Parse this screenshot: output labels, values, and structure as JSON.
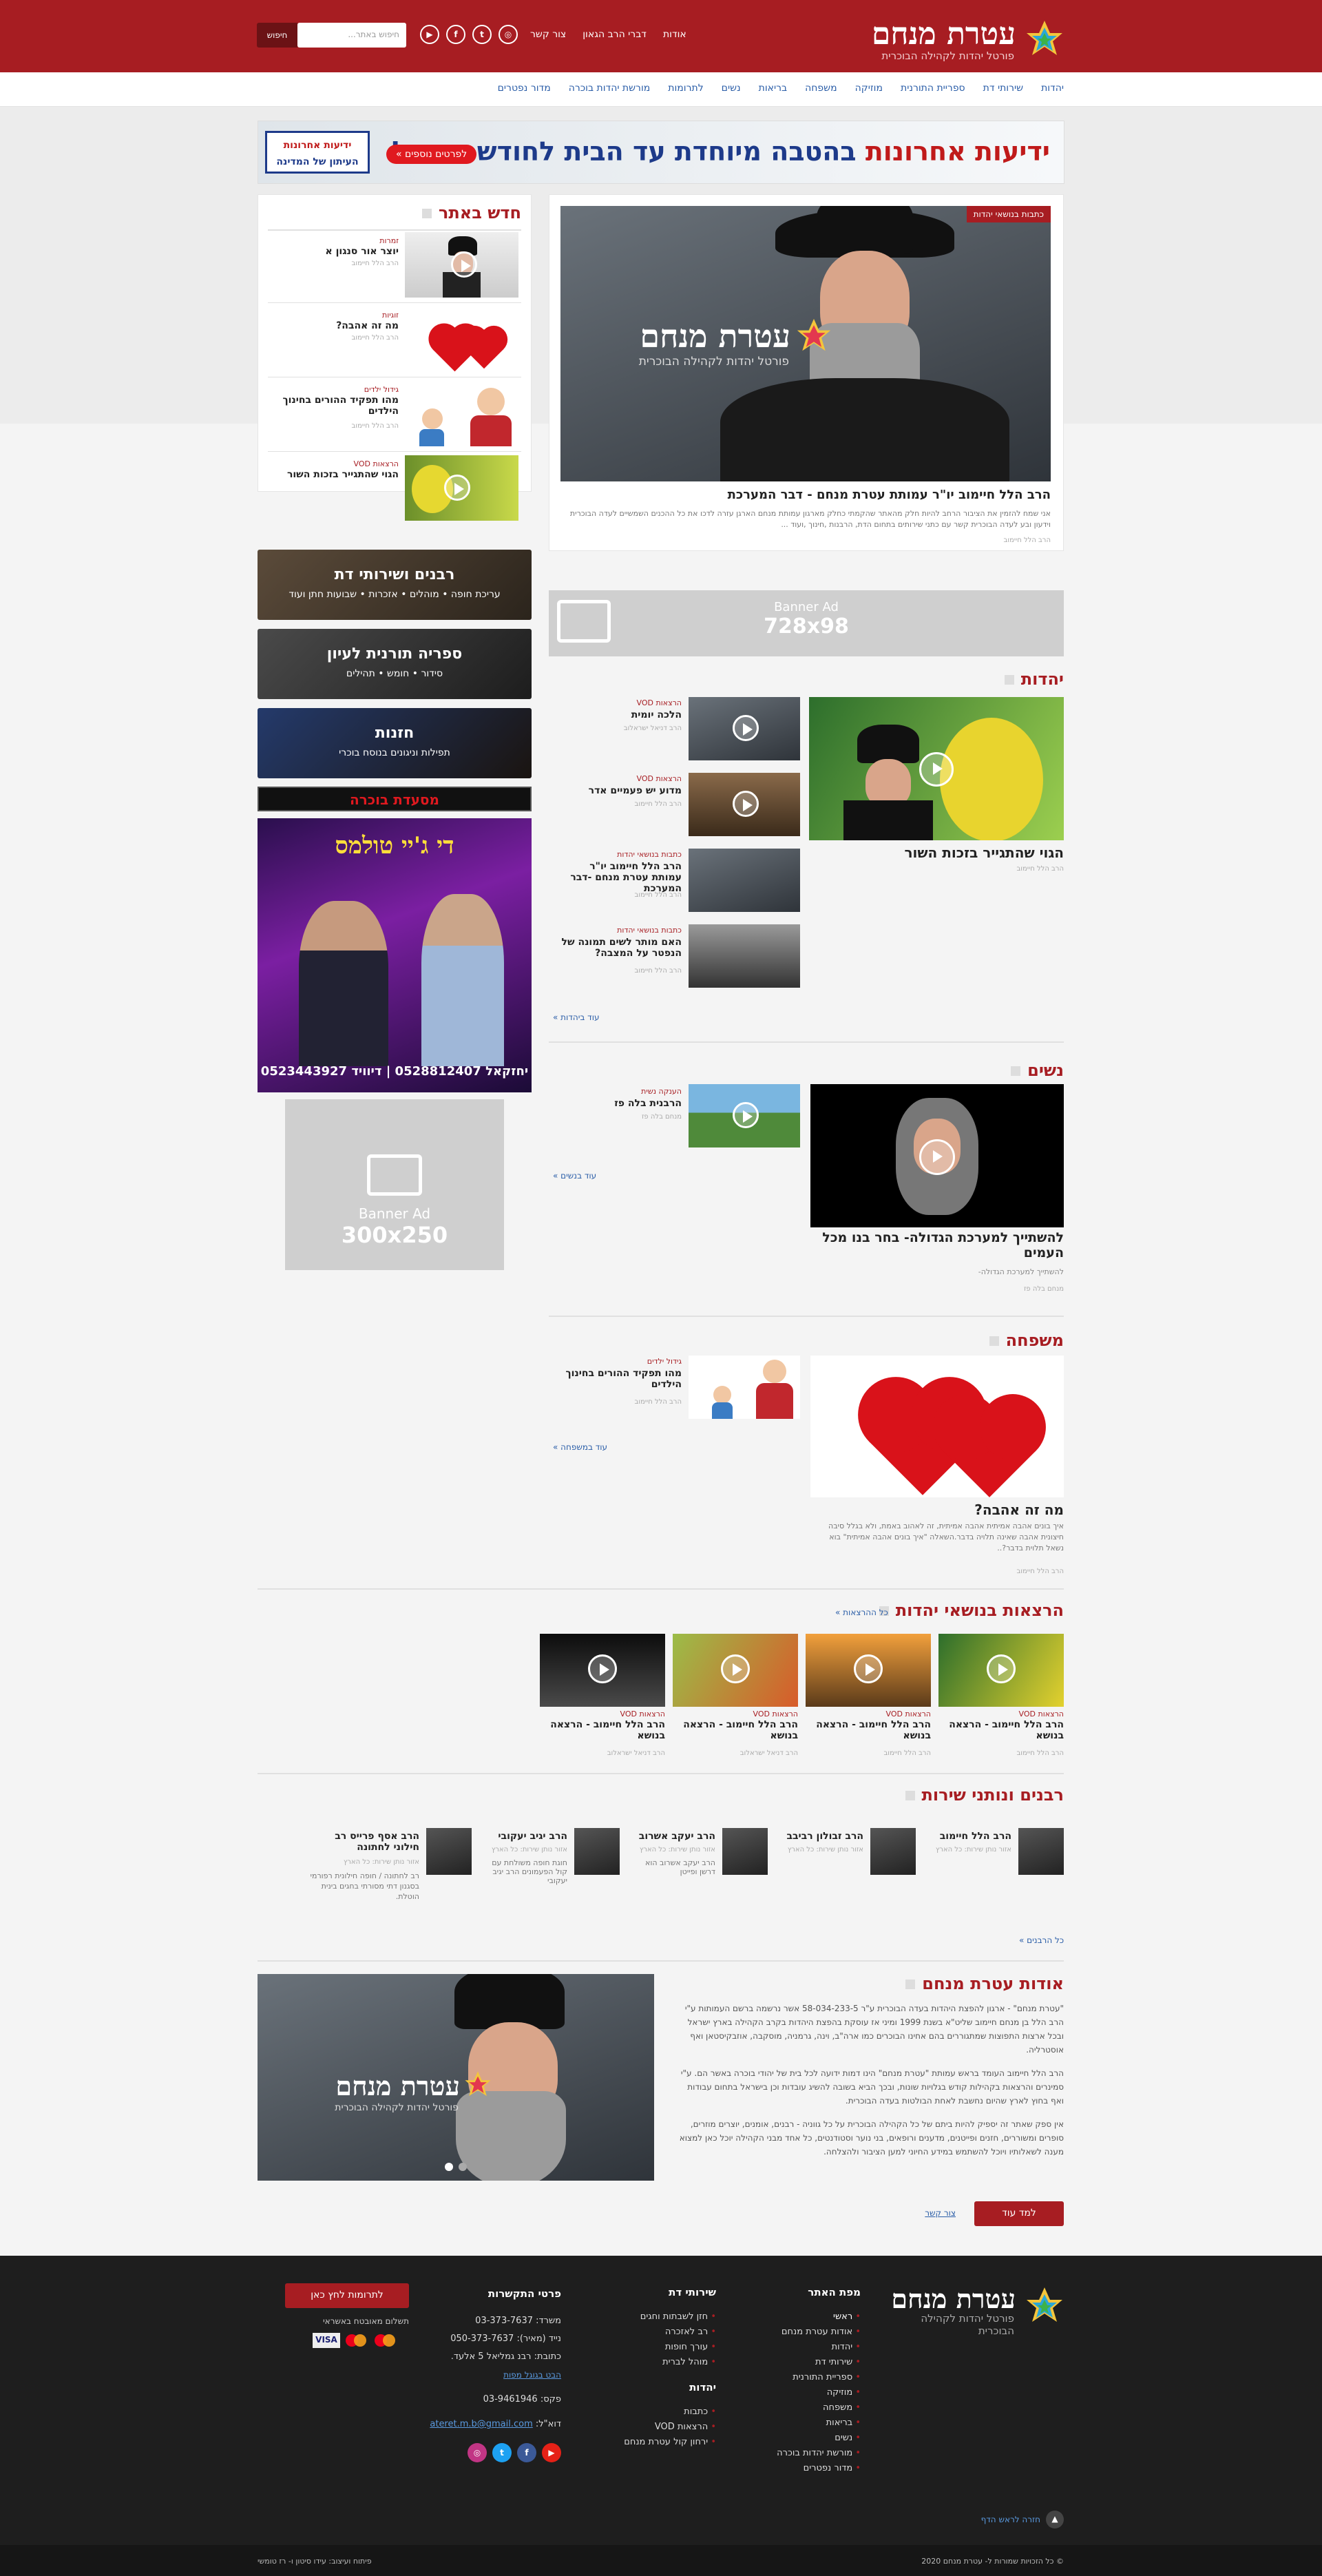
{
  "header": {
    "logo_title": "עטרת מנחם",
    "logo_sub": "פורטל יהדות לקהילה הבוכרית",
    "links": [
      "אודות",
      "דברי הרב הגאון",
      "צור קשר"
    ],
    "search_placeholder": "חיפוש באתר...",
    "search_button": "חיפוש"
  },
  "nav": [
    "יהדות",
    "שירותי דת",
    "ספריית התורנית",
    "מוזיקה",
    "משפחה",
    "בריאות",
    "נשים",
    "לתרומות",
    "מורשת יהדות בוכרה",
    "מדור נפטרים"
  ],
  "top_banner": {
    "text_main": "ידיעות אחרונות",
    "text_rest": "בהטבה מיוחדת עד הבית לחודש מתנה!",
    "button": "לפרטים נוספים »",
    "logo_l1": "ידיעות אחרונות",
    "logo_l2": "העיתון של המדינה"
  },
  "hero": {
    "tag": "כתבות בנושאי יהדות",
    "logo_title": "עטרת מנחם",
    "logo_sub": "פורטל יהדות לקהילה הבוכרית",
    "title": "הרב הלל חיימוב יו\"ר עמותת עטרת מנחם - דבר המערכת",
    "excerpt": "אני שמח להזמין את הציבור הרחב להיות חלק מהאתר שהקמתי כחלק מארגון עמותת מנחם הארגן עזרה לדכו את כל ההכנים השמשיים לעדה הבוכרית וידעון ובע לעדה הבוכרית קשר עם כתני שירותים בתחום הדת, הרבנות ,חינוך ,ועוד ...",
    "author": "הרב הלל חיימוב"
  },
  "whats_new": {
    "title": "חדש באתר",
    "items": [
      {
        "tag": "זמרות",
        "title": "יוצר אור סנגון א",
        "meta": "הרב הלל חיימוב"
      },
      {
        "tag": "זוגיות",
        "title": "מה זה אהבה?",
        "meta": "הרב הלל חיימוב"
      },
      {
        "tag": "גידול ילדים",
        "title": "מהו תפקיד ההורים בחינוך הילדים",
        "meta": "הרב הלל חיימוב"
      },
      {
        "tag": "הרצאות VOD",
        "title": "הגוי שהתגייר בזכות השור",
        "meta": "הרב הלל חיימוב"
      }
    ]
  },
  "side_cats": [
    {
      "title": "רבנים ושירותי דת",
      "sub": "עריכת חופה • מוהלים • אזכרות • שבועות חתן ועוד"
    },
    {
      "title": "ספריה תורנית לעיון",
      "sub": "סידור • חומש • תהילים"
    },
    {
      "title": "חזנות",
      "sub": "תפילות וניגונים בנוסח בוכרי"
    }
  ],
  "side_banner_text": "יחזקאל 0528812407 | דיוויד 0523443927",
  "side_banner_title": "די ג'יי טולמס",
  "side_strip": "מסעדת בוכרה",
  "ad_728": {
    "l1": "Banner Ad",
    "l2": "728x98"
  },
  "ad_300": {
    "l1": "Banner Ad",
    "l2": "300x250"
  },
  "judaism": {
    "title": "יהדות",
    "main_title": "הגוי שהתגייר בזכות השור",
    "main_meta": "הרב הלל חיימוב",
    "items": [
      {
        "tag": "הרצאות VOD",
        "title": "הלכה יומית",
        "meta": "הרב דניאל ישראלוב"
      },
      {
        "tag": "הרצאות VOD",
        "title": "מדוע יש פעמיים אדר",
        "meta": "הרב הלל חיימוב"
      },
      {
        "tag": "כתבות בנושאי יהדות",
        "title": "הרב הלל חיימוב יו\"ר עמותת עטרת מנחם -דבר המערכת",
        "meta": "הרב הלל חיימוב"
      },
      {
        "tag": "כתבות בנושאי יהדות",
        "title": "האם מותר לשים תמונה של הנפטר על המצבה?",
        "meta": "הרב הלל חיימוב"
      }
    ],
    "more": "עוד ביהדות »"
  },
  "women": {
    "title": "נשים",
    "main_title": "להשתייך למערכת הגדולה- בחר בנו מכל העמים",
    "main_excerpt": "להשתייך למערכת הגדולה-",
    "main_meta": "מנחם בלה פז",
    "items": [
      {
        "tag": "הענקה נשית",
        "title": "הרבנית בלה פז",
        "meta": "מנחם בלה פז"
      }
    ],
    "more": "עוד בנשים »"
  },
  "family": {
    "title": "משפחה",
    "main_title": "מה זה אהבה?",
    "main_excerpt": "איך בונים אהבה אמיתית אהבה אמיתית, זה לאהוב באמת, ולא בגלל סיבה חיצונית אהבה שאינה תלויה בדבר.השאלה \"איך בונים אהבה אמיתית\" בוא נשאל תלוית בדבר?..",
    "main_meta": "הרב הלל חיימוב",
    "items": [
      {
        "tag": "גידול ילדים",
        "title": "מהו תפקיד ההורים בחינוך הילדים",
        "meta": "הרב הלל חיימוב"
      }
    ],
    "more": "עוד במשפחה »"
  },
  "lectures": {
    "title": "הרצאות בנושאי יהדות",
    "more": "כל ההרצאות »",
    "items": [
      {
        "tag": "הרצאות VOD",
        "title": "הרב הלל חיימוב - הרצאה בנושא",
        "meta": "הרב הלל חיימוב"
      },
      {
        "tag": "הרצאות VOD",
        "title": "הרב הלל חיימוב - הרצאה בנושא",
        "meta": "הרב הלל חיימוב"
      },
      {
        "tag": "הרצאות VOD",
        "title": "הרב הלל חיימוב - הרצאה בנושא",
        "meta": "הרב דניאל ישראלוב"
      },
      {
        "tag": "הרצאות VOD",
        "title": "הרב הלל חיימוב - הרצאה בנושא",
        "meta": "הרב דניאל ישראלוב"
      }
    ]
  },
  "rabbis": {
    "title": "רבנים ונותני שירות",
    "more": "כל הרבנים »",
    "items": [
      {
        "name": "הרב הלל חיימוב",
        "role": "אזור נותן שירות: כל הארץ",
        "desc": ""
      },
      {
        "name": "הרב זבולון רביבב",
        "role": "אזור נותן שירות: כל הארץ",
        "desc": ""
      },
      {
        "name": "הרב יעקב אשרוב",
        "role": "אזור נותן שירות: כל הארץ",
        "desc": "הרב יעקב אשרוב הוא דרשן ופייטן"
      },
      {
        "name": "הרב יגיב יעקובי",
        "role": "אזור נותן שירות: כל הארץ",
        "desc": "חוגת חופה משולחת עם קול הפעמונים הרב יגיב יעקובי"
      },
      {
        "name": "הרב אסף פרייס רב חילוני לחתונה",
        "role": "אזור נותן שירות: כל הארץ",
        "desc": "רב לחתונה / חופה חילונית רפורמי בסגנון דתי מסורתי בחגים בינית הוטלת."
      }
    ]
  },
  "about": {
    "title": "אודות עטרת מנחם",
    "p1": "\"עטרת מנחם\" - ארגון להפצת היהדות בעדה הבוכרית ע\"ר 58-034-233-5 אשר נרשמה ברשם העמותות ע\"י הרב הלל בן מנחם חיימוב שליט\"א בשנת 1999 ומיני אז עוסקת בהפצת היהדות בקרב הקהילה בארץ ישראל ובכל ארצות התפוצות שמתגוררים בהם אחינו הבוכרים כמו ארה\"ב, וינה, גרמניה, מוסקבה, אוזבקיסטאן ואף אוסטרליה.",
    "p2": "הרב הלל חיימוב העומד בראש עמותת \"עטרת מנחם\" הינו דמות ידועה לכל בית של יהודי בוכרה באשר הם. ע\"י סמינרים והרצאות בקהילות קודש בגלויות שונות, ובכך הביא בשובה להשיג עובדות וכן בישראל בתחום עבודות ואף בחוץ לארץ שהיום נחשבת לאחת הבולטות בעדה הבוכרית.",
    "p3": "אין ספק שאתר זה יספיק להיות ביתם של כל הקהילה הבוכרית על כל גווניה - רבנים, אומנים, יוצרים מוזרים, סופרים ומשוררים, חזנים ופייטנים, מדענים ורופאים, בני נוער וסטודנטים, כל אחד מבני הקהילה יוכל כאן למצוא מענה לשאלותיו ויוכל להשתמש במידע החיוני למען הציבור ולהצלחה.",
    "btn": "למד עוד",
    "more": "צור קשר",
    "img_title": "עטרת מנחם",
    "img_sub": "פורטל יהדות לקהילה הבוכרית"
  },
  "footer": {
    "logo_title": "עטרת מנחם",
    "logo_sub": "פורטל יהדות לקהילה הבוכרית",
    "sitemap_title": "מפת האתר",
    "sitemap": [
      "ראשי",
      "אודות עטרת מנחם",
      "יהדות",
      "שירותי דת",
      "ספריית התורנית",
      "מוזיקה",
      "משפחה",
      "בריאות",
      "נשים",
      "מורשת יהדות בוכרה",
      "מדור נפטרים"
    ],
    "services_title": "שירותי דת",
    "services": [
      "חזן לשבתות וחגים",
      "רב לאזכרה",
      "עורך חופות",
      "מוהל לברית"
    ],
    "judaism_title": "יהדות",
    "judaism": [
      "כתבות",
      "הרצאות VOD",
      "ירחון קול עטרת מנחם"
    ],
    "contact_title": "פרטי התקשרות",
    "office": "משרד: 03-373-7637",
    "mobile": "נייד (מאיר): 050-373-7637",
    "address": "כתובת: רבנ גמליאל 5 אלעד.",
    "map": "הבט בגוגל מפות",
    "fax": "פקס: 03-9461946",
    "email_label": "דוא\"ל: ",
    "email": "ateret.m.b@gmail.com",
    "donate": "לתרומות לחץ כאן",
    "secure": "תשלום מאובטח באשראי",
    "top": "חזרה לראש הדף",
    "copy": "© כל הזכויות שמורות ל- עטרת מנחם 2020",
    "credit": "פיתוח ועיצוב: עידו סיטון ו- רז טומשי"
  }
}
